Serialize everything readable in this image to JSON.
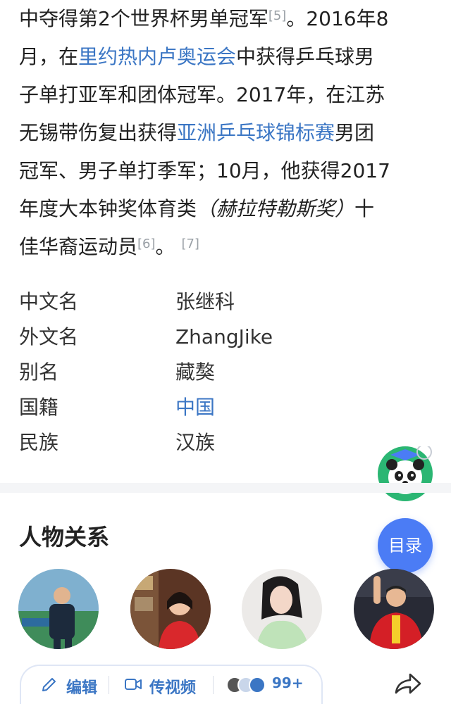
{
  "intro": {
    "line1_a": "中夺得第2个世界杯男单冠军",
    "ref5": "[5]",
    "line1_b": "。2016年8",
    "line2_a": "月，在",
    "link_rio": "里约热内卢奥运会",
    "line2_b": "中获得乒乓球男",
    "line3": "子单打亚军和团体冠军。2017年，在江苏",
    "line4_a": "无锡带伤复出获得",
    "link_asia": "亚洲乒乓球锦标赛",
    "line4_b": "男团",
    "line5": "冠军、男子单打季军；10月，他获得2017",
    "line6_a": "年度大本钟奖体育类",
    "line6_it": "（赫拉特勒斯奖）",
    "line6_b": "十",
    "line7_a": "佳华裔运动员",
    "ref6": "[6]",
    "line7_b": "。",
    "ref7": "[7]"
  },
  "info": {
    "rows": [
      {
        "key": "中文名",
        "value": "张继科"
      },
      {
        "key": "外文名",
        "value": "ZhangJike"
      },
      {
        "key": "别名",
        "value": "藏獒"
      },
      {
        "key": "国籍",
        "value": "中国"
      },
      {
        "key": "民族",
        "value": "汉族"
      }
    ]
  },
  "section": {
    "title": "人物关系"
  },
  "toc": {
    "label": "目录"
  },
  "bottom": {
    "edit_label": "编辑",
    "video_label": "传视频",
    "count": "99+"
  },
  "colors": {
    "link": "#3b76c4",
    "toc_bg": "#4b7cf5"
  }
}
